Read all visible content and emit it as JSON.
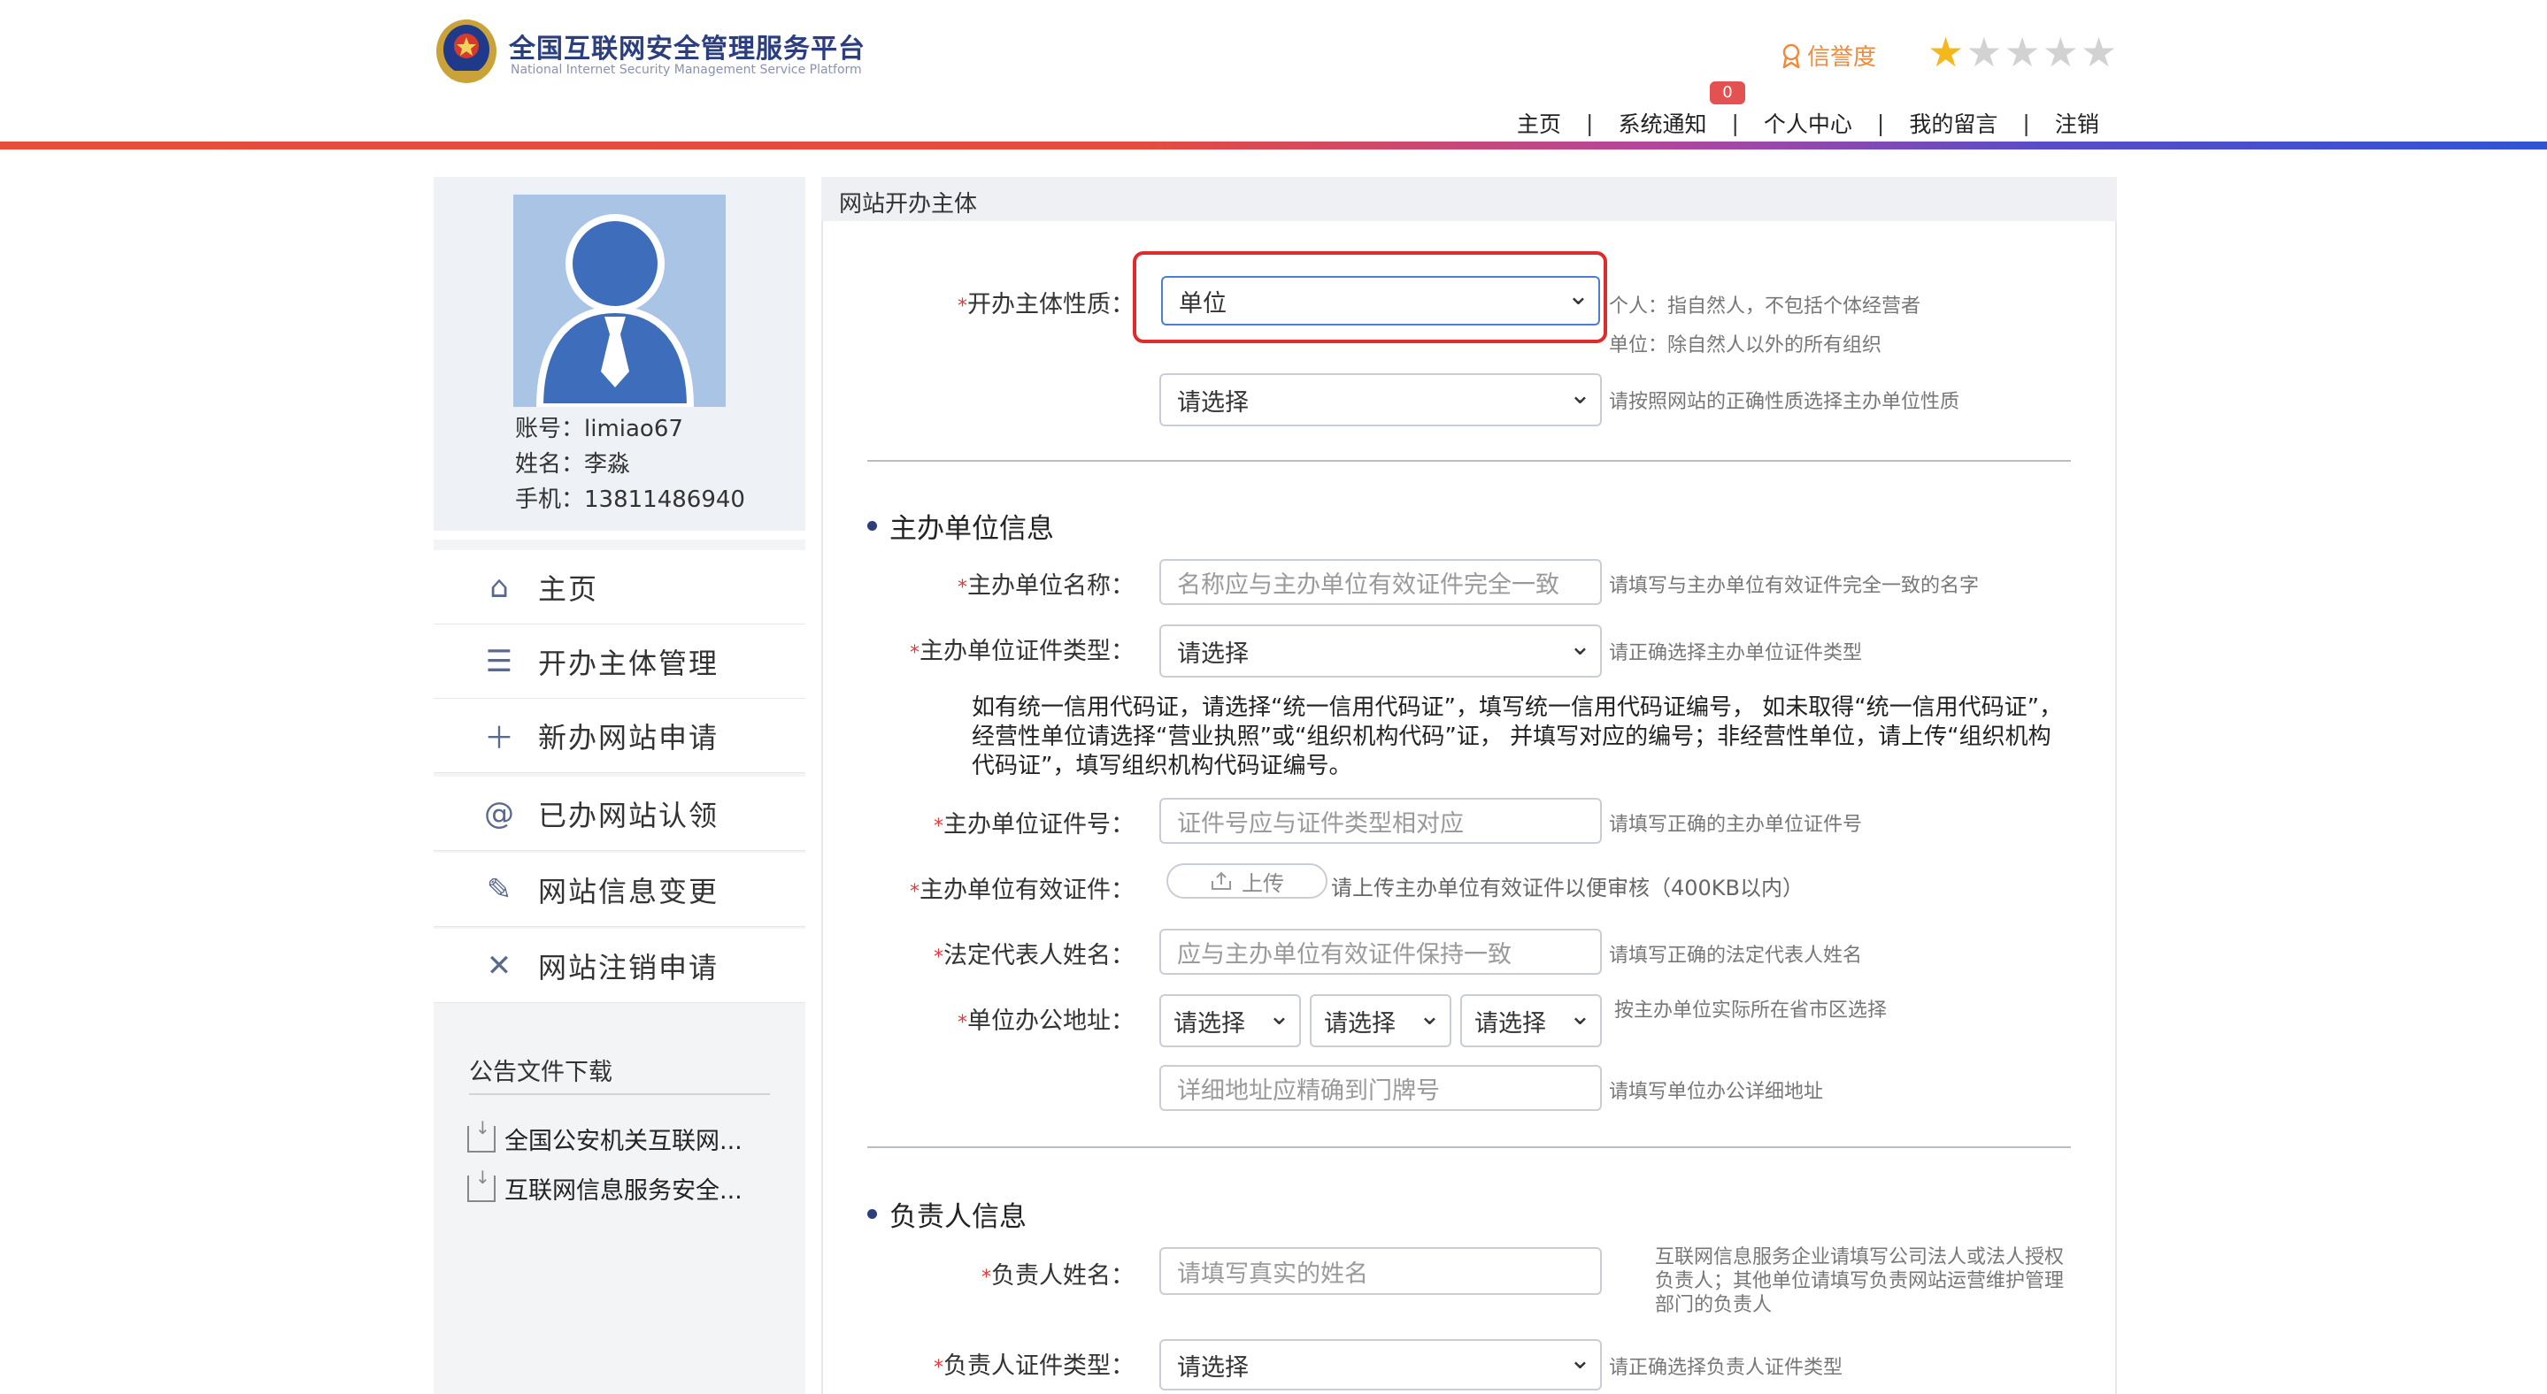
{
  "header": {
    "title": "全国互联网安全管理服务平台",
    "subtitle": "National Internet Security Management Service Platform",
    "credit_label": "信誉度",
    "stars_filled": 1,
    "stars_total": 5,
    "notice_count": "0",
    "nav": [
      "主页",
      "系统通知",
      "个人中心",
      "我的留言",
      "注销"
    ]
  },
  "profile": {
    "account": "账号：limiao67",
    "name": "姓名：李淼",
    "phone": "手机：13811486940"
  },
  "menu": [
    {
      "label": "主页",
      "icon": "home-icon"
    },
    {
      "label": "开办主体管理",
      "icon": "list-icon"
    },
    {
      "label": "新办网站申请",
      "icon": "plus-icon"
    },
    {
      "label": "已办网站认领",
      "icon": "at-icon"
    },
    {
      "label": "网站信息变更",
      "icon": "edit-icon"
    },
    {
      "label": "网站注销申请",
      "icon": "close-icon"
    }
  ],
  "downloads": {
    "title": "公告文件下载",
    "items": [
      "全国公安机关互联网...",
      "互联网信息服务安全..."
    ]
  },
  "panel": {
    "title": "网站开办主体",
    "nature_label": "开办主体性质：",
    "nature_value": "单位",
    "nature_hint1": "个人：指自然人，不包括个体经营者",
    "nature_hint2": "单位：除自然人以外的所有组织",
    "unit_type_value": "请选择",
    "unit_type_hint": "请按照网站的正确性质选择主办单位性质",
    "section1": "主办单位信息",
    "unit_name_label": "主办单位名称：",
    "unit_name_placeholder": "名称应与主办单位有效证件完全一致",
    "unit_name_hint": "请填写与主办单位有效证件完全一致的名字",
    "cert_type_label": "主办单位证件类型：",
    "cert_type_value": "请选择",
    "cert_type_hint": "请正确选择主办单位证件类型",
    "cert_note": "如有统一信用代码证，请选择“统一信用代码证”，填写统一信用代码证编号， 如未取得“统一信用代码证”，经营性单位请选择“营业执照”或“组织机构代码”证， 并填写对应的编号；非经营性单位，请上传“组织机构代码证”，填写组织机构代码证编号。",
    "cert_no_label": "主办单位证件号：",
    "cert_no_placeholder": "证件号应与证件类型相对应",
    "cert_no_hint": "请填写正确的主办单位证件号",
    "cert_file_label": "主办单位有效证件：",
    "upload_label": "上传",
    "cert_file_hint": "请上传主办单位有效证件以便审核（400KB以内）",
    "legal_label": "法定代表人姓名：",
    "legal_placeholder": "应与主办单位有效证件保持一致",
    "legal_hint": "请填写正确的法定代表人姓名",
    "address_label": "单位办公地址：",
    "province_value": "请选择",
    "city_value": "请选择",
    "district_value": "请选择",
    "address_hint": "按主办单位实际所在省市区选择",
    "address_detail_placeholder": "详细地址应精确到门牌号",
    "address_detail_hint": "请填写单位办公详细地址",
    "section2": "负责人信息",
    "resp_name_label": "负责人姓名：",
    "resp_name_placeholder": "请填写真实的姓名",
    "resp_name_hint": "互联网信息服务企业请填写公司法人或法人授权负责人；其他单位请填写负责网站运营维护管理部门的负责人",
    "resp_cert_label": "负责人证件类型：",
    "resp_cert_value": "请选择",
    "resp_cert_hint": "请正确选择负责人证件类型"
  },
  "colors": {
    "brand": "#2b3f80",
    "required": "#e23b3b",
    "highlight": "#e02b2b",
    "credit": "#f08a3c",
    "star": "#f5b81c"
  }
}
